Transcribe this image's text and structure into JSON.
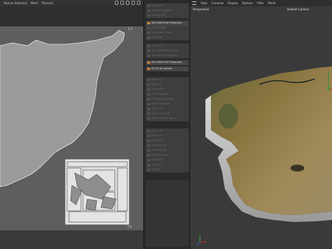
{
  "uv_editor": {
    "menu": [
      "Texture Selection",
      "Mesh",
      "Textures"
    ],
    "icons": [
      "lock-icon",
      "grid-icon",
      "link-icon",
      "folder-icon",
      "home-icon"
    ],
    "corner_top": "1,1",
    "corner_bottom": "1,0"
  },
  "commands": {
    "group1": [
      "Relax UV",
      "Optimal Mapping",
      "Realign UV"
    ],
    "group2": [
      "Set UVW from Projection",
      "UV Manager",
      "UV Terrain Mesh",
      "UV Relax"
    ],
    "group3": [
      "UV Tools",
      "UV Transform Mapping",
      "Transfer UV Mapping"
    ],
    "single1": "Set UVW from Projection",
    "single2": "Fit UV to Canvas",
    "group4": [
      "Mirror U",
      "Mirror V",
      "Rotate UV",
      "UV Straighten",
      "UV Rectangularize",
      "Align UV Island",
      "Stitch UV",
      "Weld UV Points",
      "Normalize UV Island"
    ],
    "group5": [
      "Copy UV",
      "Paste UV",
      "Select UV",
      "Unstitch UV",
      "Pack Islands",
      "UV Projection",
      "Rotate UV",
      "Scale UV",
      "Shrink"
    ]
  },
  "viewport": {
    "menu": [
      "View",
      "Cameras",
      "Display",
      "Options",
      "Filter",
      "Panel"
    ],
    "title": "Perspective",
    "camera": "Default Camera"
  },
  "colors": {
    "accent_orange": "#d28a3a",
    "uv_bg": "#5e5e5e",
    "shape_fill": "#9a9a9a"
  }
}
